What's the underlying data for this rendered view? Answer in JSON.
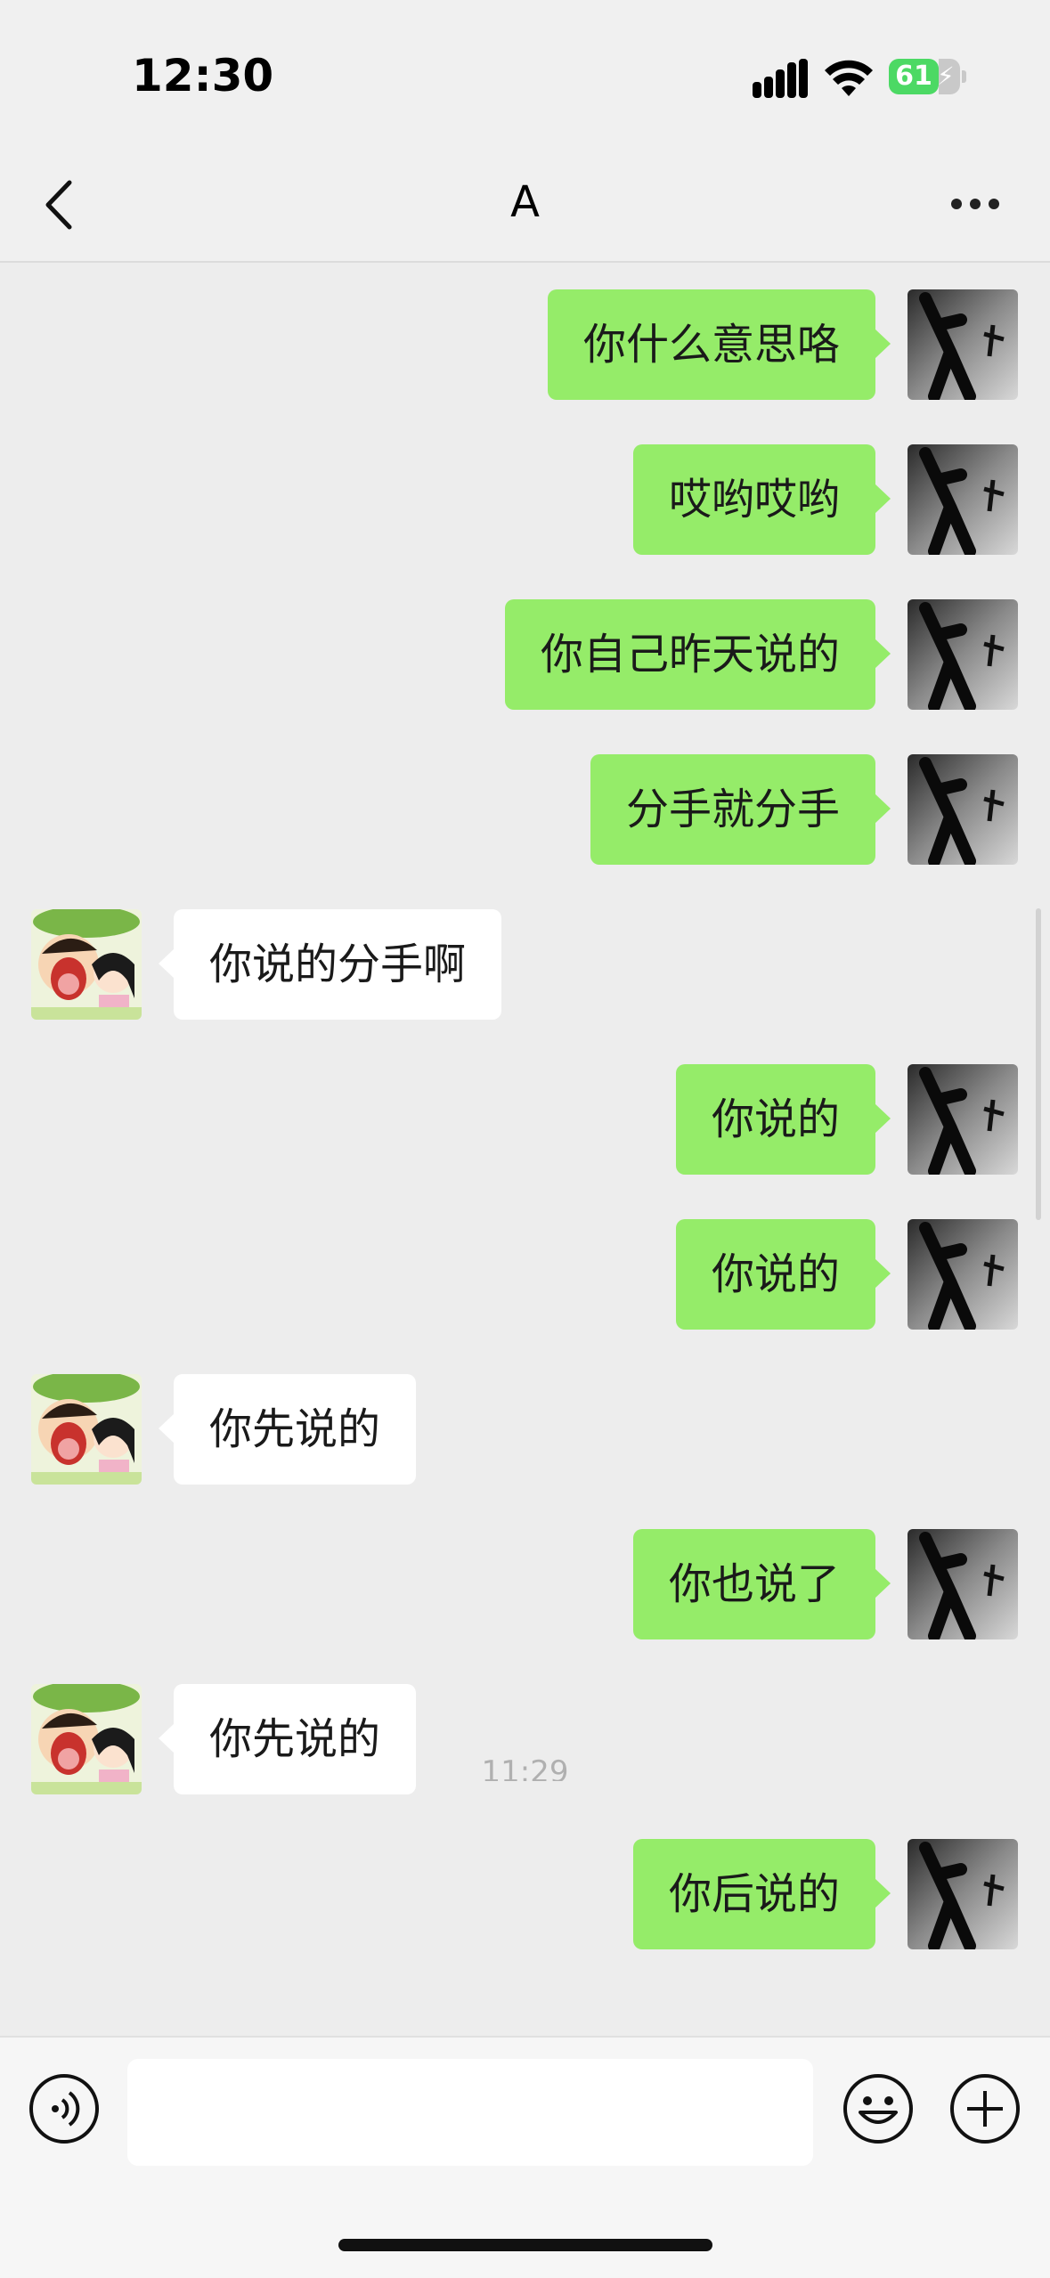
{
  "status_bar": {
    "time": "12:30",
    "battery": "61"
  },
  "header": {
    "title": "A"
  },
  "messages": [
    {
      "side": "me",
      "text": "你什么意思咯"
    },
    {
      "side": "me",
      "text": "哎哟哎哟"
    },
    {
      "side": "me",
      "text": "你自己昨天说的"
    },
    {
      "side": "me",
      "text": "分手就分手"
    },
    {
      "side": "other",
      "text": "你说的分手啊"
    },
    {
      "side": "me",
      "text": "你说的"
    },
    {
      "side": "me",
      "text": "你说的"
    },
    {
      "side": "other",
      "text": "你先说的"
    },
    {
      "side": "me",
      "text": "你也说了"
    },
    {
      "side": "other",
      "text": "你先说的"
    },
    {
      "side": "me",
      "text": "你后说的"
    }
  ],
  "partial_timestamp": "11:29",
  "input": {
    "value": ""
  },
  "colors": {
    "outgoing_bubble": "#95ec69",
    "incoming_bubble": "#ffffff",
    "background": "#ededed"
  },
  "icons": {
    "back": "chevron-left-icon",
    "more": "more-horizontal-icon",
    "voice": "voice-icon",
    "emoji": "emoji-icon",
    "plus": "plus-icon"
  }
}
